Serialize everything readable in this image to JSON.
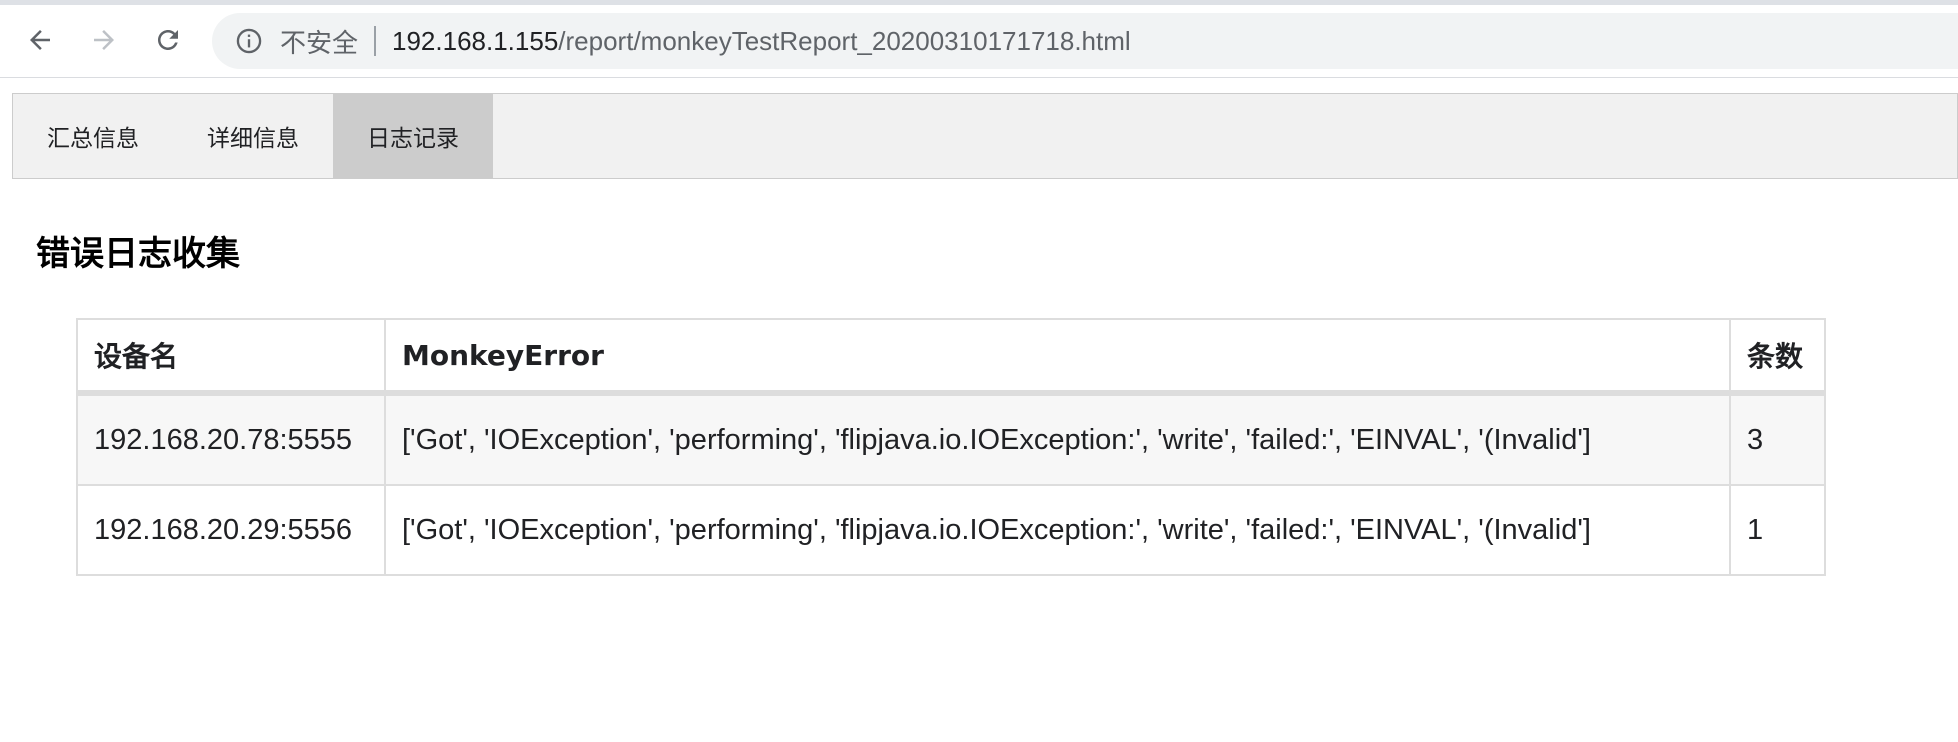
{
  "browser": {
    "security_label": "不安全",
    "url_host": "192.168.1.155",
    "url_path": "/report/monkeyTestReport_20200310171718.html",
    "icons": [
      "back-arrow-icon",
      "forward-arrow-icon",
      "reload-icon",
      "info-icon"
    ]
  },
  "tabs": [
    {
      "label": "汇总信息",
      "active": false
    },
    {
      "label": "详细信息",
      "active": false
    },
    {
      "label": "日志记录",
      "active": true
    }
  ],
  "section": {
    "title": "错误日志收集"
  },
  "table": {
    "headers": [
      "设备名",
      "MonkeyError",
      "条数"
    ],
    "rows": [
      {
        "device": "192.168.20.78:5555",
        "error": "['Got', 'IOException', 'performing', 'flipjava.io.IOException:', 'write', 'failed:', 'EINVAL', '(Invalid']",
        "count": "3"
      },
      {
        "device": "192.168.20.29:5556",
        "error": "['Got', 'IOException', 'performing', 'flipjava.io.IOException:', 'write', 'failed:', 'EINVAL', '(Invalid']",
        "count": "1"
      }
    ]
  },
  "colors": {
    "active_tab": "#cccccc",
    "tabbar_bg": "#f1f1f1",
    "border": "#dddddd"
  }
}
